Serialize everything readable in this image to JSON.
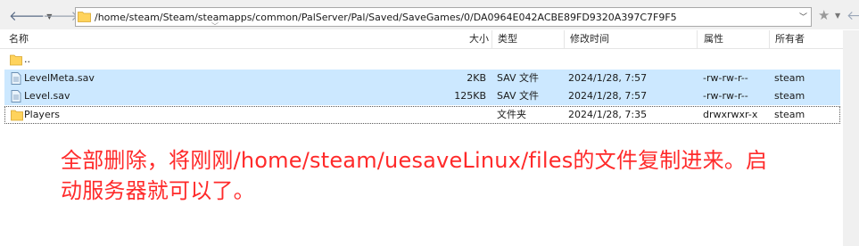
{
  "address_bar": {
    "path": "/home/steam/Steam/steamapps/common/PalServer/Pal/Saved/SaveGames/0/DA0964E042ACBE89FD9320A397C7F9F5"
  },
  "columns": {
    "name": "名称",
    "size": "大小",
    "type": "类型",
    "modified": "修改时间",
    "attributes": "属性",
    "owner": "所有者"
  },
  "files": [
    {
      "name": "..",
      "size": "",
      "type": "",
      "modified": "",
      "attributes": "",
      "owner": "",
      "icon": "folder-icon",
      "selected": false,
      "focused": false
    },
    {
      "name": "LevelMeta.sav",
      "size": "2KB",
      "type": "SAV 文件",
      "modified": "2024/1/28, 7:57",
      "attributes": "-rw-rw-r--",
      "owner": "steam",
      "icon": "file-icon",
      "selected": true,
      "focused": false
    },
    {
      "name": "Level.sav",
      "size": "125KB",
      "type": "SAV 文件",
      "modified": "2024/1/28, 7:57",
      "attributes": "-rw-rw-r--",
      "owner": "steam",
      "icon": "file-icon",
      "selected": true,
      "focused": false
    },
    {
      "name": "Players",
      "size": "",
      "type": "文件夹",
      "modified": "2024/1/28, 7:35",
      "attributes": "drwxrwxr-x",
      "owner": "steam",
      "icon": "folder-icon",
      "selected": false,
      "focused": true
    }
  ],
  "annotation": {
    "line1": "全部删除，将刚刚/home/steam/uesaveLinux/files的文件复制进来。启",
    "line2": "动服务器就可以了。"
  },
  "colors": {
    "selection": "#cce8ff",
    "annotation": "#ff2a2a",
    "folder": "#ffd35c"
  }
}
